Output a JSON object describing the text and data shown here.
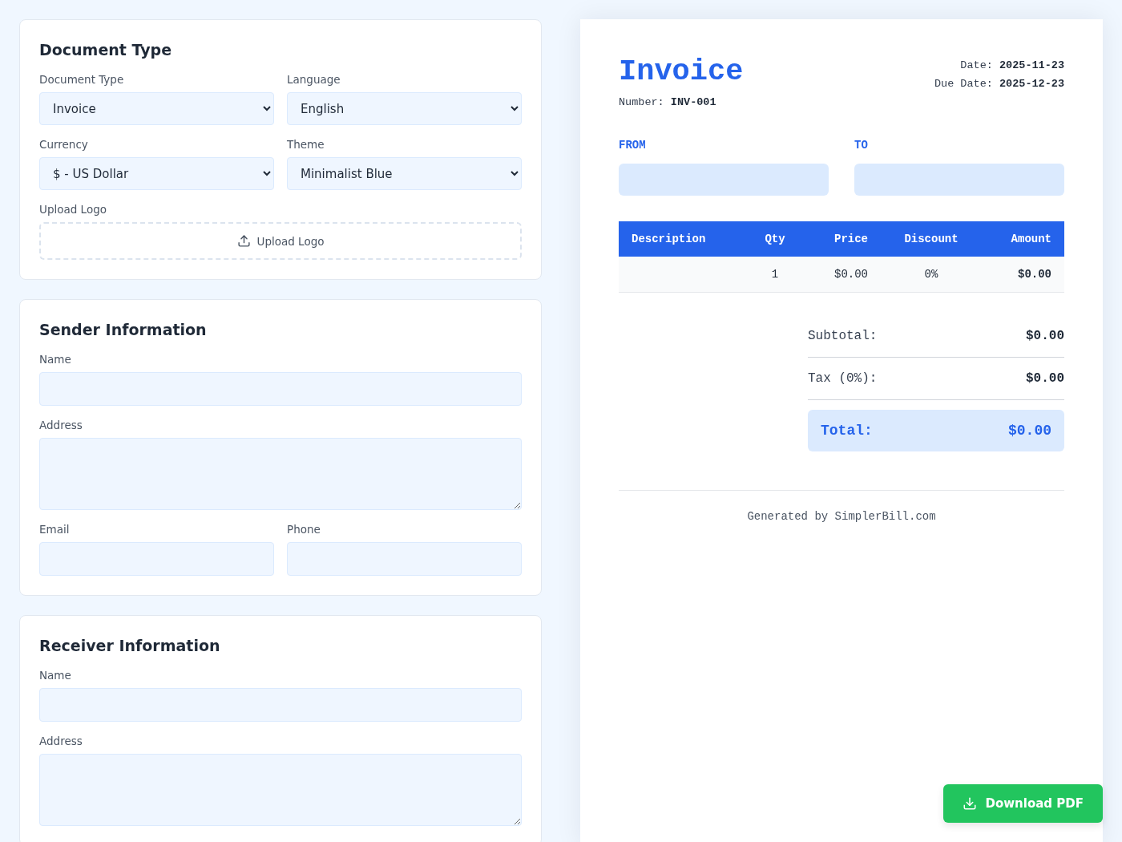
{
  "form": {
    "sections": [
      {
        "title": "Document Type",
        "rows": [
          [
            {
              "kind": "select",
              "label": "Document Type",
              "value": "Invoice"
            },
            {
              "kind": "select",
              "label": "Language",
              "value": "English"
            }
          ],
          [
            {
              "kind": "select",
              "label": "Currency",
              "value": "$ - US Dollar"
            },
            {
              "kind": "select",
              "label": "Theme",
              "value": "Minimalist Blue"
            }
          ],
          [
            {
              "kind": "upload",
              "label": "Upload Logo",
              "button": "Upload Logo"
            }
          ]
        ]
      },
      {
        "title": "Sender Information",
        "rows": [
          [
            {
              "kind": "text",
              "label": "Name"
            }
          ],
          [
            {
              "kind": "textarea",
              "label": "Address"
            }
          ],
          [
            {
              "kind": "text",
              "label": "Email"
            },
            {
              "kind": "text",
              "label": "Phone"
            }
          ]
        ]
      },
      {
        "title": "Receiver Information",
        "rows": [
          [
            {
              "kind": "text",
              "label": "Name"
            }
          ],
          [
            {
              "kind": "textarea",
              "label": "Address"
            }
          ]
        ]
      }
    ]
  },
  "preview": {
    "title": "Invoice",
    "number_label": "Number:",
    "number": "INV-001",
    "dates": [
      {
        "label": "Date:",
        "value": "2025-11-23"
      },
      {
        "label": "Due Date:",
        "value": "2025-12-23"
      }
    ],
    "parties": [
      {
        "label": "FROM"
      },
      {
        "label": "TO"
      }
    ],
    "table": {
      "columns": [
        "Description",
        "Qty",
        "Price",
        "Discount",
        "Amount"
      ],
      "rows": [
        {
          "qty": "1",
          "price": "$0.00",
          "discount": "0%",
          "amount": "$0.00"
        }
      ]
    },
    "totals": [
      {
        "label": "Subtotal:",
        "value": "$0.00"
      },
      {
        "label": "Tax (0%):",
        "value": "$0.00"
      }
    ],
    "total": {
      "label": "Total:",
      "value": "$0.00"
    },
    "footer": "Generated by SimplerBill.com"
  },
  "download_button": "Download PDF"
}
